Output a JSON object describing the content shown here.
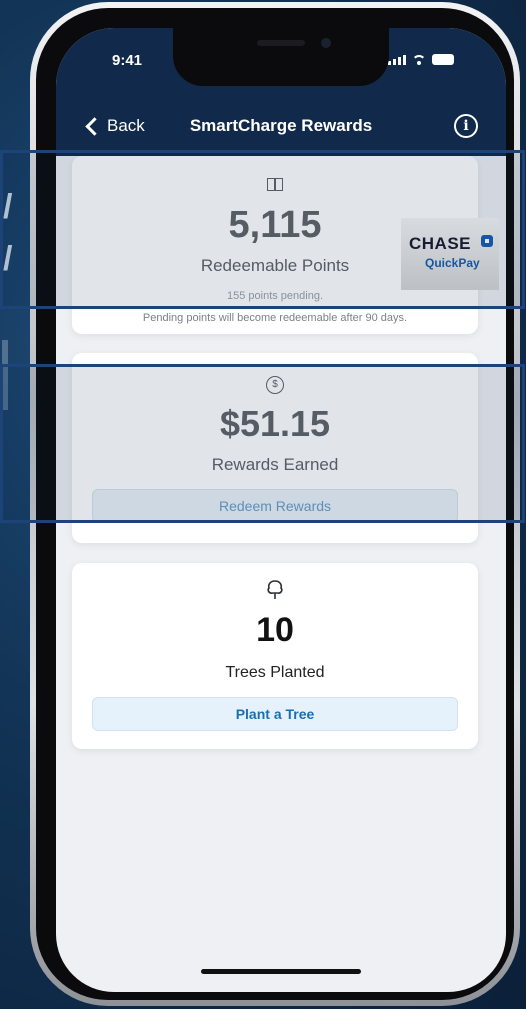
{
  "status_bar": {
    "time": "9:41"
  },
  "nav": {
    "back_label": "Back",
    "title": "SmartCharge Rewards"
  },
  "points_card": {
    "value": "5,115",
    "label": "Redeemable Points",
    "pending": "155 points pending.",
    "note": "Pending points will become redeemable after 90 days."
  },
  "promo": {
    "brand": "CHASE",
    "product": "QuickPay"
  },
  "rewards_card": {
    "value": "$51.15",
    "label": "Rewards Earned",
    "button_label": "Redeem Rewards"
  },
  "trees_card": {
    "value": "10",
    "label": "Trees Planted",
    "button_label": "Plant a Tree"
  },
  "colors": {
    "header": "#11294a",
    "button_text": "#1a6fb1",
    "highlight_border": "#1c4478"
  },
  "icons": [
    "chevron-left-icon",
    "info-icon",
    "gift-icon",
    "dollar-coin-icon",
    "tree-icon"
  ]
}
